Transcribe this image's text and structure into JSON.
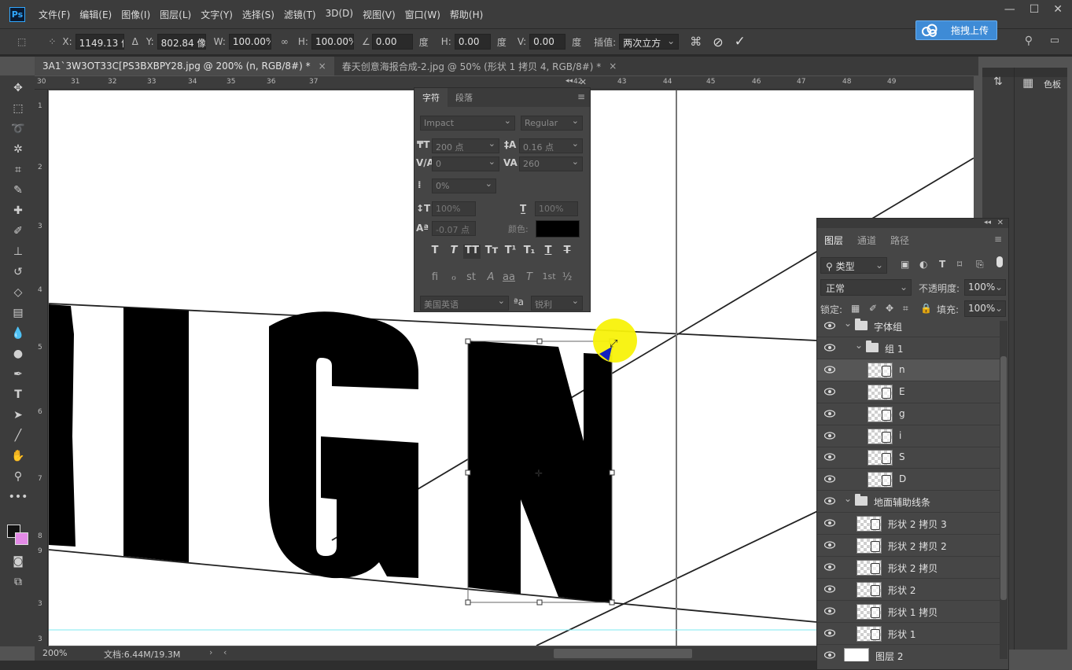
{
  "menubar": {
    "logo": "Ps",
    "items": [
      "文件(F)",
      "编辑(E)",
      "图像(I)",
      "图层(L)",
      "文字(Y)",
      "选择(S)",
      "滤镜(T)",
      "3D(D)",
      "视图(V)",
      "窗口(W)",
      "帮助(H)"
    ]
  },
  "options": {
    "x_label": "X:",
    "x_value": "1149.13 像",
    "y_label": "Y:",
    "y_value": "802.84 像]",
    "w_label": "W:",
    "w_value": "100.00%",
    "h_label": "H:",
    "h_value": "100.00%",
    "angle_value": "0.00",
    "degree": "度",
    "hskew_label": "H:",
    "hskew_value": "0.00",
    "vskew_label": "V:",
    "vskew_value": "0.00",
    "interp_label": "插值:",
    "interp_value": "两次立方"
  },
  "upload_button": "拖拽上传",
  "tabs": [
    {
      "label": "3A1`3W3OT33C[PS3BXBPY28.jpg @ 200% (n, RGB/8#) *",
      "close": "×"
    },
    {
      "label": "春天创意海报合成-2.jpg @ 50% (形状 1 拷贝 4, RGB/8#) *",
      "close": "×"
    }
  ],
  "ruler_top": [
    "30",
    "31",
    "32",
    "33",
    "34",
    "35",
    "36",
    "37",
    "42",
    "43",
    "44",
    "45",
    "46",
    "47",
    "48",
    "49"
  ],
  "ruler_left": [
    "1",
    "2",
    "3",
    "4",
    "5",
    "6",
    "7",
    "8",
    "9",
    "3",
    "3"
  ],
  "canvas_text": "SIGN",
  "status": {
    "zoom": "200%",
    "doc": "文档:6.44M/19.3M"
  },
  "char_panel": {
    "tab_char": "字符",
    "tab_para": "段落",
    "font_family": "Impact",
    "font_style": "Regular",
    "size": "200 点",
    "leading": "0.16 点",
    "kerning": "0",
    "tracking": "260",
    "scale_pct": "0%",
    "vscale": "100%",
    "hscale": "100%",
    "baseline": "-0.07 点",
    "color_label": "颜色:",
    "language": "美国英语",
    "antialias": "锐利",
    "aa_icon": "ªa",
    "style_buttons": [
      "T",
      "T",
      "TT",
      "Tт",
      "T¹",
      "T₁",
      "T",
      "T"
    ],
    "ot_buttons": [
      "fi",
      "ℴ",
      "st",
      "A",
      "aa",
      "T",
      "1st",
      "½"
    ]
  },
  "right_strip": {
    "swatches": "色板"
  },
  "layers_panel": {
    "tabs": [
      "图层",
      "通道",
      "路径"
    ],
    "filter": "类型",
    "blend": "正常",
    "opacity_label": "不透明度:",
    "opacity": "100%",
    "lock_label": "锁定:",
    "fill_label": "填充:",
    "fill": "100%",
    "rows": [
      {
        "name": "字体组",
        "type": "group",
        "indent": 0
      },
      {
        "name": "组 1",
        "type": "group",
        "indent": 1
      },
      {
        "name": "n",
        "type": "layer",
        "indent": 2
      },
      {
        "name": "E",
        "type": "layer",
        "indent": 2
      },
      {
        "name": "g",
        "type": "layer",
        "indent": 2
      },
      {
        "name": "i",
        "type": "layer",
        "indent": 2
      },
      {
        "name": "S",
        "type": "layer",
        "indent": 2
      },
      {
        "name": "D",
        "type": "layer",
        "indent": 2
      },
      {
        "name": "地面辅助线条",
        "type": "group",
        "indent": 0
      },
      {
        "name": "形状 2 拷贝 3",
        "type": "layer",
        "indent": 1
      },
      {
        "name": "形状 2 拷贝 2",
        "type": "layer",
        "indent": 1
      },
      {
        "name": "形状 2 拷贝",
        "type": "layer",
        "indent": 1
      },
      {
        "name": "形状 2",
        "type": "layer",
        "indent": 1
      },
      {
        "name": "形状 1 拷贝",
        "type": "layer",
        "indent": 1
      },
      {
        "name": "形状 1",
        "type": "layer",
        "indent": 1
      },
      {
        "name": "图层 2",
        "type": "white",
        "indent": 0
      }
    ]
  }
}
